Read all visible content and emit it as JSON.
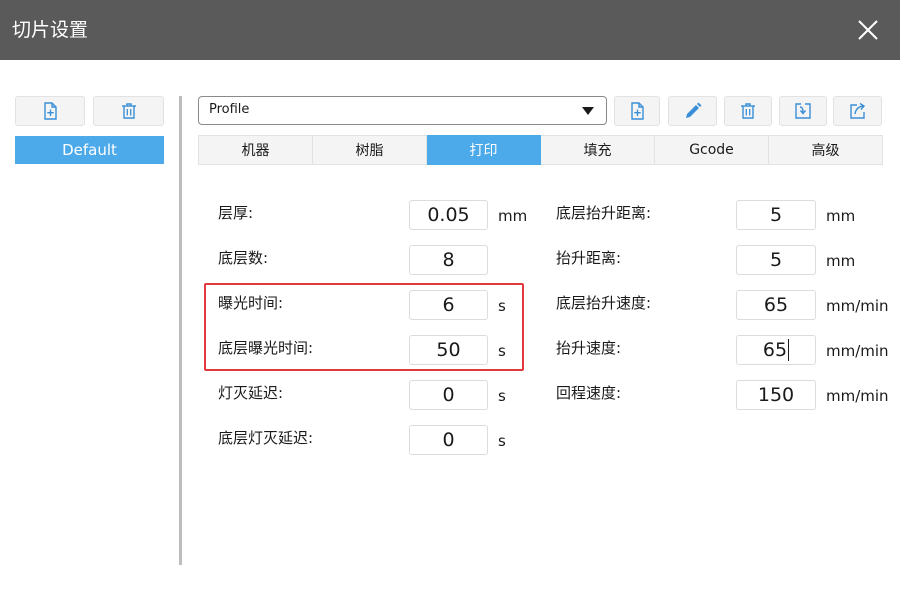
{
  "window": {
    "title": "切片设置"
  },
  "left_panel": {
    "default_item": "Default"
  },
  "profile": {
    "selected": "Profile"
  },
  "tabs": [
    {
      "label": "机器",
      "active": false
    },
    {
      "label": "树脂",
      "active": false
    },
    {
      "label": "打印",
      "active": true
    },
    {
      "label": "填充",
      "active": false
    },
    {
      "label": "Gcode",
      "active": false
    },
    {
      "label": "高级",
      "active": false
    }
  ],
  "left_fields": [
    {
      "label": "层厚:",
      "value": "0.05",
      "unit": "mm"
    },
    {
      "label": "底层数:",
      "value": "8",
      "unit": ""
    },
    {
      "label": "曝光时间:",
      "value": "6",
      "unit": "s"
    },
    {
      "label": "底层曝光时间:",
      "value": "50",
      "unit": "s"
    },
    {
      "label": "灯灭延迟:",
      "value": "0",
      "unit": "s"
    },
    {
      "label": "底层灯灭延迟:",
      "value": "0",
      "unit": "s"
    }
  ],
  "right_fields": [
    {
      "label": "底层抬升距离:",
      "value": "5",
      "unit": "mm"
    },
    {
      "label": "抬升距离:",
      "value": "5",
      "unit": "mm"
    },
    {
      "label": "底层抬升速度:",
      "value": "65",
      "unit": "mm/min"
    },
    {
      "label": "抬升速度:",
      "value": "65",
      "unit": "mm/min"
    },
    {
      "label": "回程速度:",
      "value": "150",
      "unit": "mm/min"
    }
  ],
  "colors": {
    "accent": "#4ca9ea",
    "titlebar": "#5a5a5a",
    "highlight": "#e0393e"
  }
}
